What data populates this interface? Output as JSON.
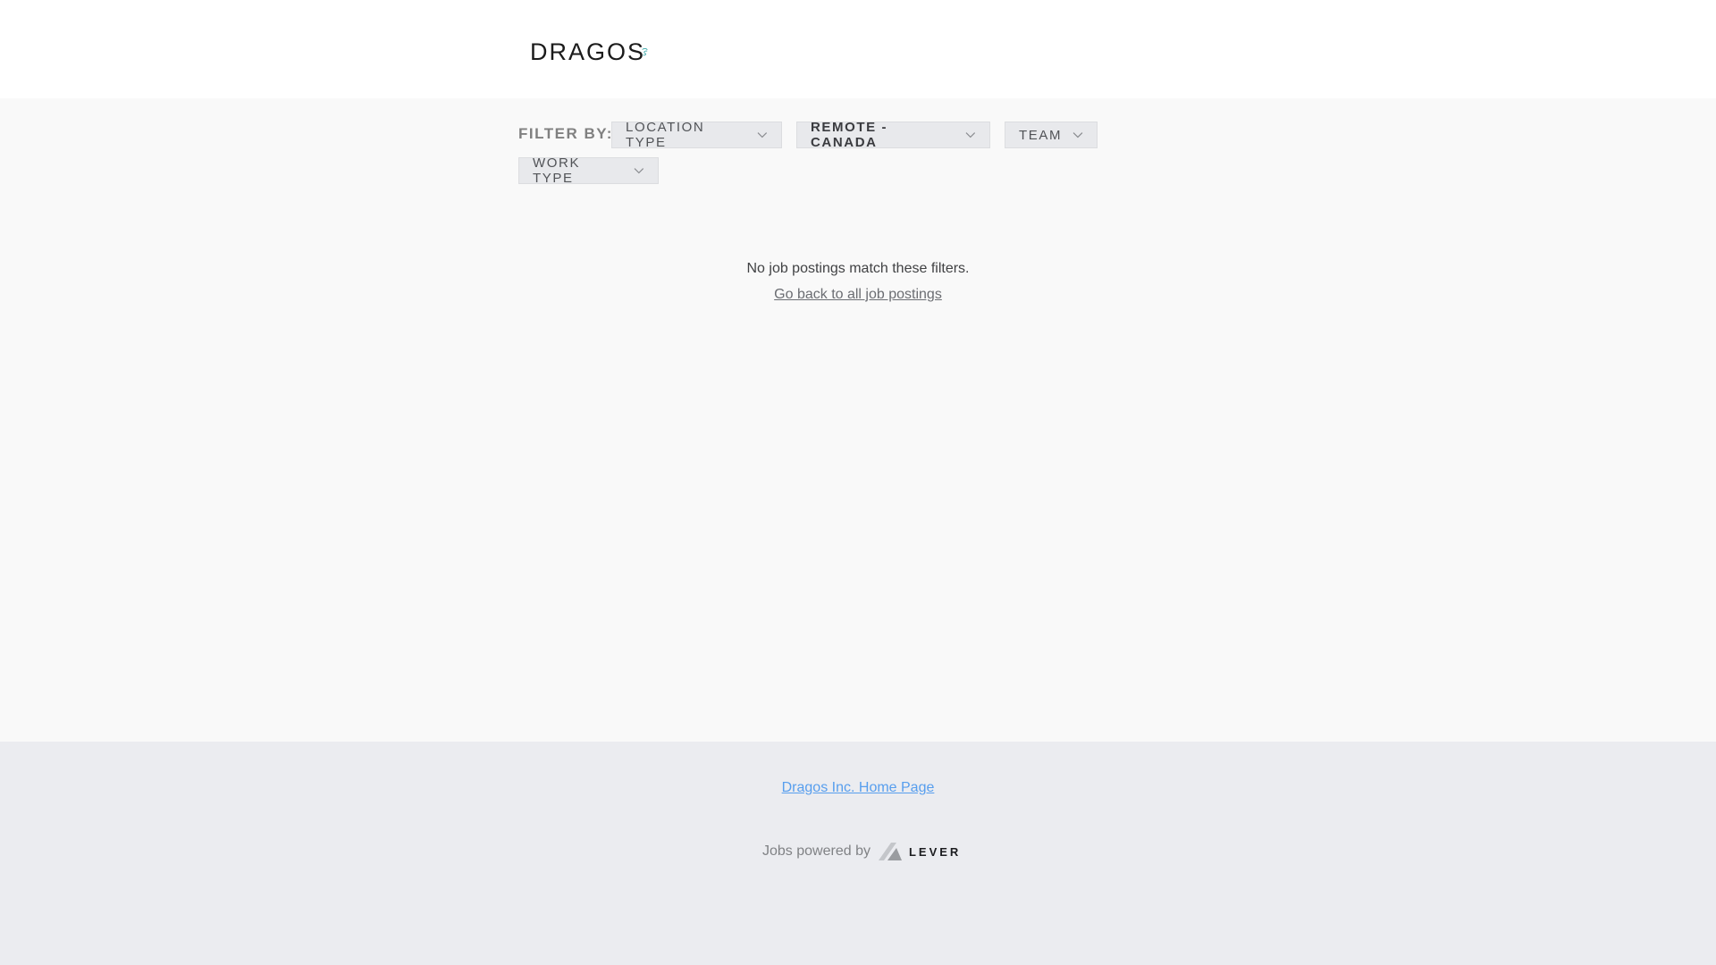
{
  "header": {
    "logo_text": "DRAGOS",
    "logo_icon": "dragos-logo-icon"
  },
  "filters": {
    "label": "FILTER BY:",
    "location_type": "LOCATION TYPE",
    "location": "REMOTE - CANADA",
    "team": "TEAM",
    "work_type": "WORK TYPE",
    "chevron_icon": "chevron-down-icon"
  },
  "results": {
    "empty_message": "No job postings match these filters.",
    "back_link": "Go back to all job postings"
  },
  "footer": {
    "home_link": "Dragos Inc. Home Page",
    "powered_by": "Jobs powered by",
    "lever_text": "LEVER",
    "lever_icon": "lever-logo-icon"
  },
  "colors": {
    "link_blue": "#579eee",
    "footer_bg": "#ebecf0",
    "body_bg": "#f9f9f9",
    "logo_teal": "#1a9a9a"
  }
}
